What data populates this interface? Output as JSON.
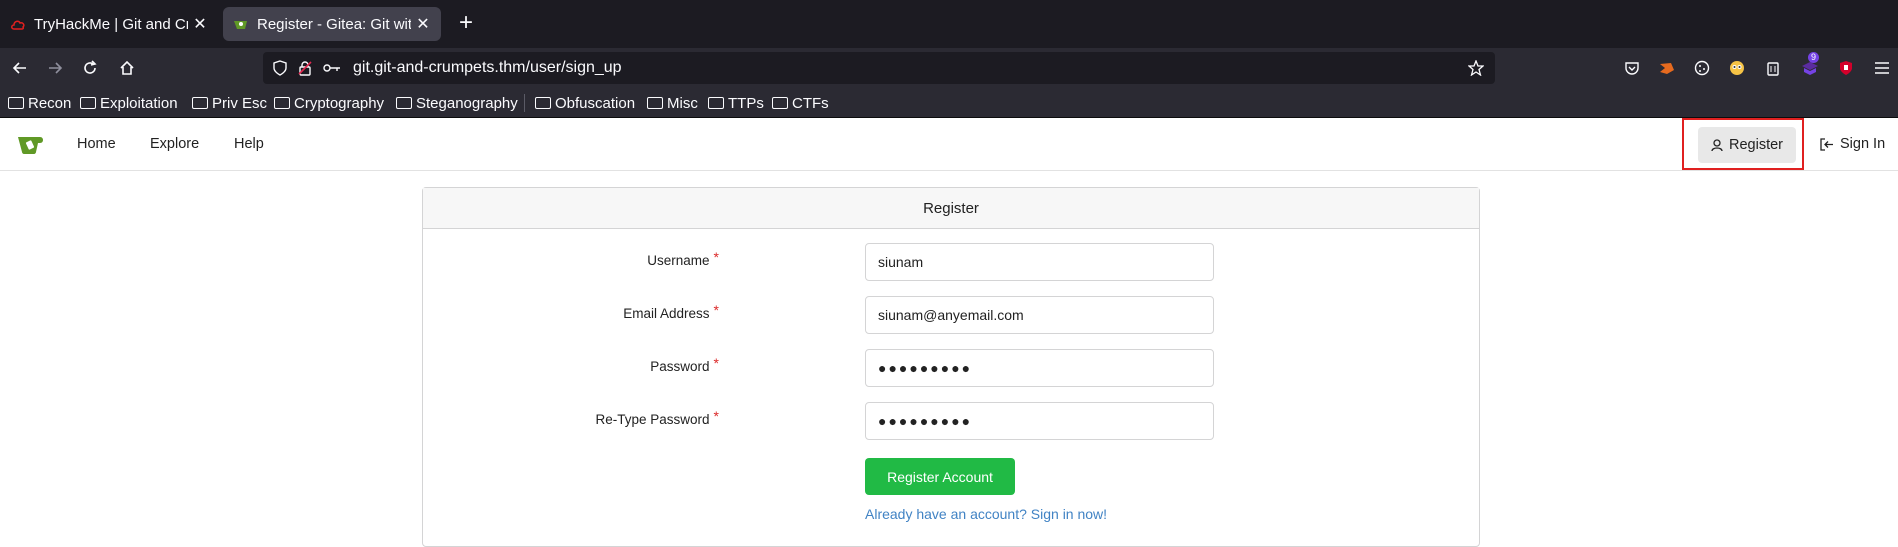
{
  "browser": {
    "tabs": [
      {
        "title": "TryHackMe | Git and Crum",
        "active": false
      },
      {
        "title": "Register - Gitea: Git with a",
        "active": true
      }
    ],
    "url": "git.git-and-crumpets.thm/user/sign_up",
    "bookmarks": [
      "Recon",
      "Exploitation",
      "Priv Esc",
      "Cryptography",
      "Steganography",
      "Obfuscation",
      "Misc",
      "TTPs",
      "CTFs"
    ],
    "extension_badge": "9"
  },
  "site_nav": {
    "links": [
      "Home",
      "Explore",
      "Help"
    ],
    "register_label": "Register",
    "signin_label": "Sign In"
  },
  "form": {
    "title": "Register",
    "fields": [
      {
        "label": "Username",
        "value": "siunam"
      },
      {
        "label": "Email Address",
        "value": "siunam@anyemail.com"
      },
      {
        "label": "Password",
        "value": "●●●●●●●●●"
      },
      {
        "label": "Re-Type Password",
        "value": "●●●●●●●●●"
      }
    ],
    "required_marker": "*",
    "submit_label": "Register Account",
    "signin_link": "Already have an account? Sign in now!"
  },
  "colors": {
    "accent_green": "#21ba45",
    "link_blue": "#4183c4",
    "highlight_red": "#e02020"
  }
}
